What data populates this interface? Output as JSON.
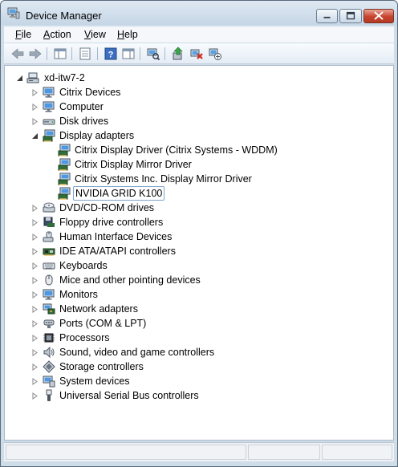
{
  "window": {
    "title": "Device Manager"
  },
  "menubar": [
    {
      "label": "File",
      "accel": "F"
    },
    {
      "label": "Action",
      "accel": "A"
    },
    {
      "label": "View",
      "accel": "V"
    },
    {
      "label": "Help",
      "accel": "H"
    }
  ],
  "toolbar": [
    {
      "name": "back-button",
      "icon": "back-arrow-icon"
    },
    {
      "name": "forward-button",
      "icon": "forward-arrow-icon"
    },
    {
      "name": "show-hide-console-tree-button",
      "icon": "console-tree-icon"
    },
    {
      "name": "properties-button",
      "icon": "properties-icon"
    },
    {
      "name": "help-button",
      "icon": "help-icon"
    },
    {
      "name": "show-action-pane-button",
      "icon": "action-pane-icon"
    },
    {
      "name": "scan-hardware-button",
      "icon": "scan-hardware-icon"
    },
    {
      "name": "update-driver-button",
      "icon": "update-driver-icon"
    },
    {
      "name": "uninstall-button",
      "icon": "uninstall-icon"
    },
    {
      "name": "disable-device-button",
      "icon": "disable-device-icon"
    }
  ],
  "tree": {
    "root": {
      "label": "xd-itw7-2",
      "icon": "computer-icon",
      "expanded": true
    },
    "categories": [
      {
        "label": "Citrix Devices",
        "icon": "monitor-icon",
        "expanded": false
      },
      {
        "label": "Computer",
        "icon": "monitor-icon",
        "expanded": false
      },
      {
        "label": "Disk drives",
        "icon": "disk-drive-icon",
        "expanded": false
      },
      {
        "label": "Display adapters",
        "icon": "display-adapter-icon",
        "expanded": true,
        "children": [
          {
            "label": "Citrix Display Driver (Citrix Systems - WDDM)",
            "icon": "display-adapter-icon"
          },
          {
            "label": "Citrix Display Mirror Driver",
            "icon": "display-adapter-icon"
          },
          {
            "label": "Citrix Systems Inc. Display Mirror Driver",
            "icon": "display-adapter-icon"
          },
          {
            "label": "NVIDIA GRID K100",
            "icon": "display-adapter-icon",
            "selected": true
          }
        ]
      },
      {
        "label": "DVD/CD-ROM drives",
        "icon": "dvd-drive-icon",
        "expanded": false
      },
      {
        "label": "Floppy drive controllers",
        "icon": "floppy-controller-icon",
        "expanded": false
      },
      {
        "label": "Human Interface Devices",
        "icon": "hid-icon",
        "expanded": false
      },
      {
        "label": "IDE ATA/ATAPI controllers",
        "icon": "ide-controller-icon",
        "expanded": false
      },
      {
        "label": "Keyboards",
        "icon": "keyboard-icon",
        "expanded": false
      },
      {
        "label": "Mice and other pointing devices",
        "icon": "mouse-icon",
        "expanded": false
      },
      {
        "label": "Monitors",
        "icon": "monitor-icon",
        "expanded": false
      },
      {
        "label": "Network adapters",
        "icon": "network-adapter-icon",
        "expanded": false
      },
      {
        "label": "Ports (COM & LPT)",
        "icon": "port-icon",
        "expanded": false
      },
      {
        "label": "Processors",
        "icon": "processor-icon",
        "expanded": false
      },
      {
        "label": "Sound, video and game controllers",
        "icon": "speaker-icon",
        "expanded": false
      },
      {
        "label": "Storage controllers",
        "icon": "storage-controller-icon",
        "expanded": false
      },
      {
        "label": "System devices",
        "icon": "system-devices-icon",
        "expanded": false
      },
      {
        "label": "Universal Serial Bus controllers",
        "icon": "usb-icon",
        "expanded": false
      }
    ]
  },
  "colors": {
    "frame": "#cfdde9",
    "selection_border": "#7da2ce",
    "close_button": "#c6432d"
  }
}
